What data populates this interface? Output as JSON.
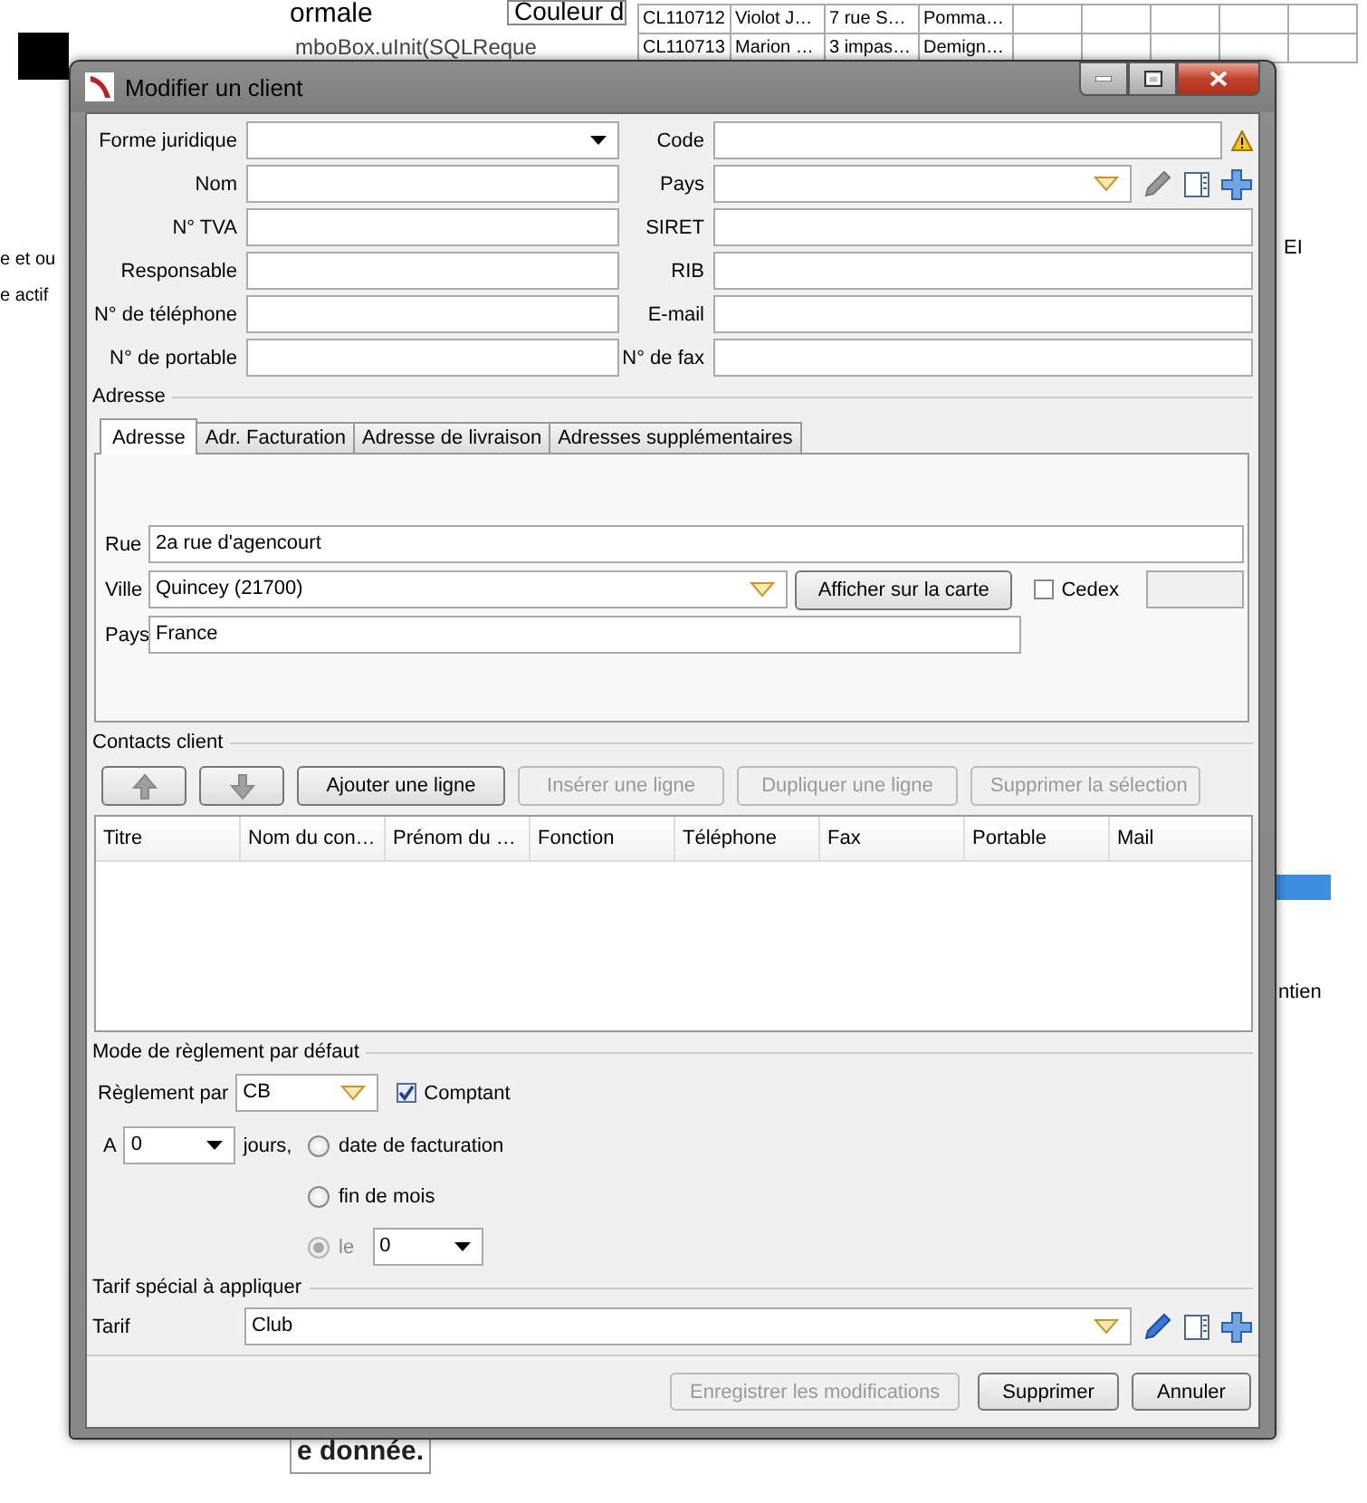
{
  "background": {
    "table_rows": [
      [
        "CL110712",
        "Violot J…",
        "7 rue S…",
        "Pomma…"
      ],
      [
        "CL110713",
        "Marion …",
        "3 impas…",
        "Demign…"
      ]
    ],
    "texts": [
      "ormale",
      "Couleur d",
      "mboBox.uInit(SQLReque",
      "e et ou",
      "e actif",
      "EI",
      "ntien",
      "e donnée."
    ]
  },
  "window": {
    "title": "Modifier un client"
  },
  "rows": [
    {
      "left": {
        "label": "Forme juridique",
        "kind": "dropdown"
      },
      "right": {
        "label": "Code",
        "kind": "text_warning"
      }
    },
    {
      "left": {
        "label": "Nom",
        "kind": "text"
      },
      "right": {
        "label": "Pays",
        "kind": "lookup",
        "edit_enabled": false
      }
    },
    {
      "left": {
        "label": "N° TVA",
        "kind": "text"
      },
      "right": {
        "label": "SIRET",
        "kind": "text"
      }
    },
    {
      "left": {
        "label": "Responsable",
        "kind": "text"
      },
      "right": {
        "label": "RIB",
        "kind": "text"
      }
    },
    {
      "left": {
        "label": "N° de téléphone",
        "kind": "text"
      },
      "right": {
        "label": "E-mail",
        "kind": "text"
      }
    },
    {
      "left": {
        "label": "N° de portable",
        "kind": "text"
      },
      "right": {
        "label": "N° de fax",
        "kind": "text"
      }
    }
  ],
  "address": {
    "legend": "Adresse",
    "tabs": [
      {
        "label": "Adresse",
        "selected": true
      },
      {
        "label": "Adr. Facturation",
        "selected": false
      },
      {
        "label": "Adresse de livraison",
        "selected": false
      },
      {
        "label": "Adresses supplémentaires",
        "selected": false
      }
    ],
    "street": {
      "label": "Rue",
      "value": "2a rue d'agencourt"
    },
    "city": {
      "label": "Ville",
      "value": "Quincey (21700)"
    },
    "map_button": "Afficher sur la carte",
    "cedex": {
      "label": "Cedex",
      "checked": false
    },
    "country": {
      "label": "Pays",
      "value": "France"
    }
  },
  "contacts": {
    "legend": "Contacts client",
    "buttons": [
      {
        "kind": "up",
        "disabled": false
      },
      {
        "kind": "down",
        "disabled": false
      },
      {
        "kind": "text",
        "label": "Ajouter une ligne",
        "disabled": false
      },
      {
        "kind": "text",
        "label": "Insérer une ligne",
        "disabled": true
      },
      {
        "kind": "text",
        "label": "Dupliquer une ligne",
        "disabled": true
      },
      {
        "kind": "text",
        "label": "Supprimer la sélection",
        "disabled": true
      }
    ],
    "columns": [
      "Titre",
      "Nom du con…",
      "Prénom du …",
      "Fonction",
      "Téléphone",
      "Fax",
      "Portable",
      "Mail"
    ]
  },
  "payment": {
    "legend": "Mode de règlement par défaut",
    "method_label": "Règlement par",
    "method": "CB",
    "cash": {
      "label": "Comptant",
      "checked": true
    },
    "delay_label": "A",
    "delay": "0",
    "days_label": "jours,",
    "options": [
      {
        "label": "date de facturation",
        "selected": false,
        "disabled": false
      },
      {
        "label": "fin de mois",
        "selected": false,
        "disabled": false
      },
      {
        "label": "le",
        "selected": true,
        "disabled": true
      }
    ],
    "day": "0"
  },
  "tariff": {
    "legend": "Tarif spécial à appliquer",
    "label": "Tarif",
    "value": "Club",
    "edit_enabled": true
  },
  "footer_buttons": [
    {
      "label": "Enregistrer les modifications",
      "disabled": true
    },
    {
      "label": "Supprimer",
      "disabled": false
    },
    {
      "label": "Annuler",
      "disabled": false
    }
  ]
}
